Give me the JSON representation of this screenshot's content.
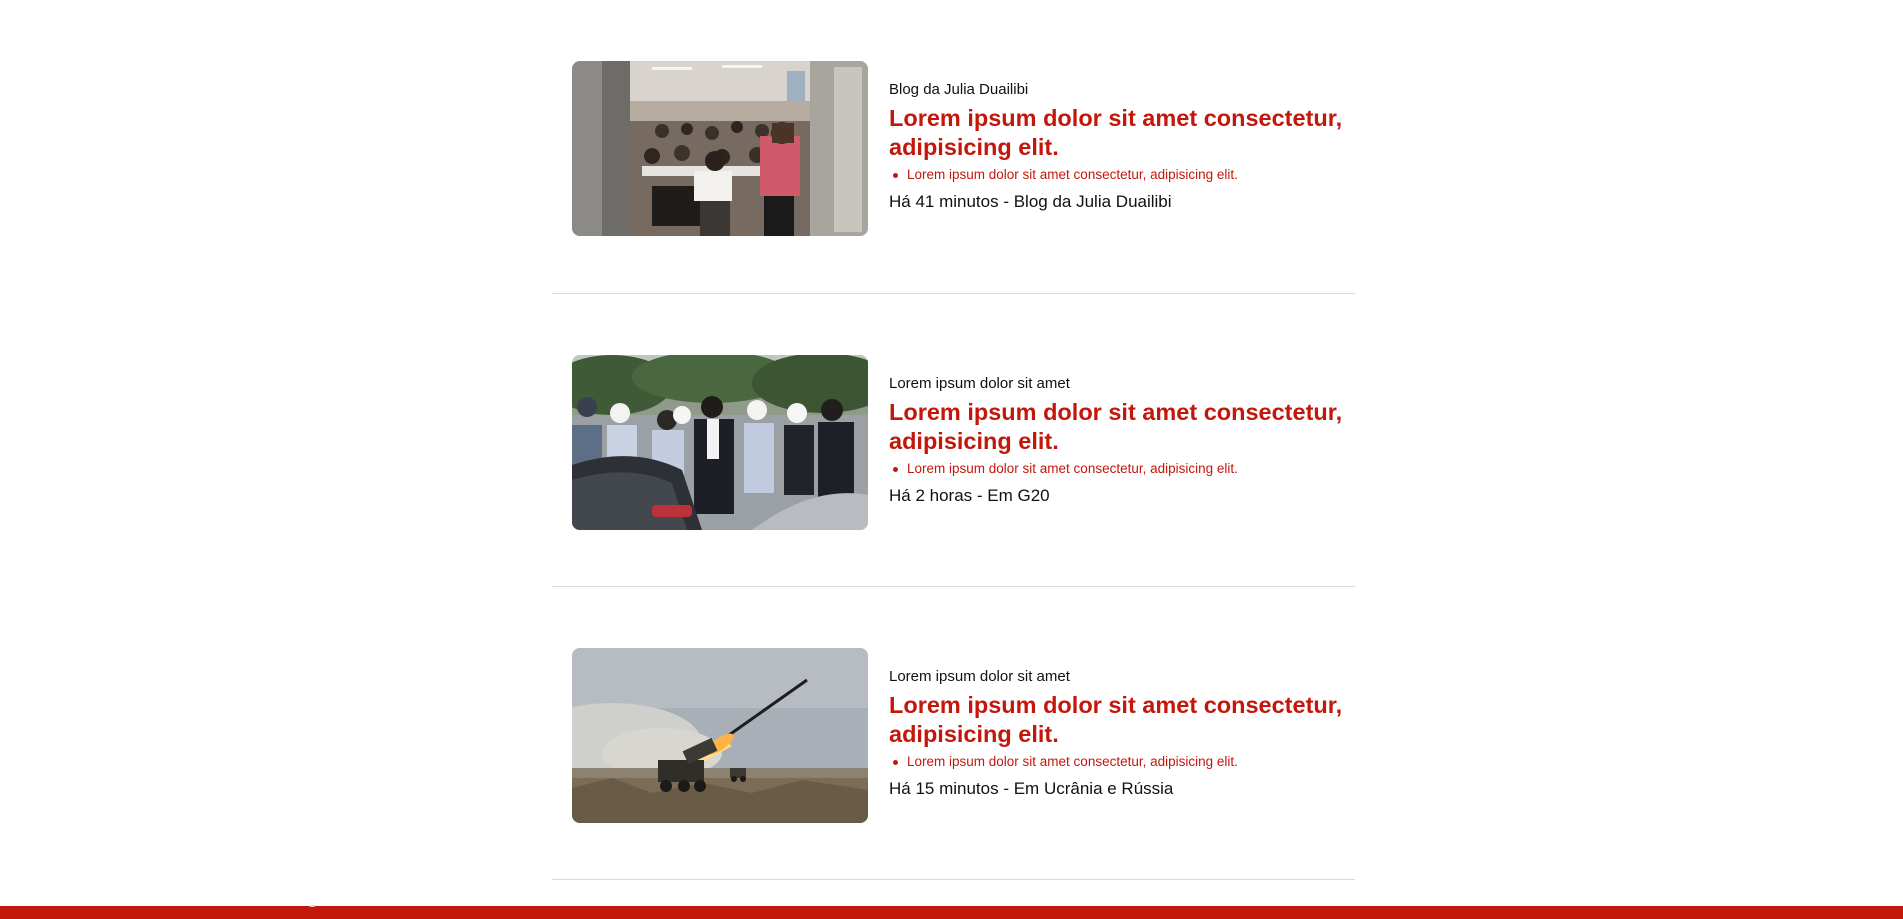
{
  "feed": {
    "items": [
      {
        "kicker": "Blog da Julia Duailibi",
        "headline": "Lorem ipsum dolor sit amet consectetur, adipisicing elit.",
        "bullet": "Lorem ipsum dolor sit amet consectetur, adipisicing elit.",
        "meta": "Há 41 minutos - Blog da Julia Duailibi",
        "image": "classroom-exam-photo"
      },
      {
        "kicker": "Lorem ipsum dolor sit amet",
        "headline": "Lorem ipsum dolor sit amet consectetur, adipisicing elit.",
        "bullet": "Lorem ipsum dolor sit amet consectetur, adipisicing elit.",
        "meta": "Há 2 horas - Em G20",
        "image": "officials-arrival-photo"
      },
      {
        "kicker": "Lorem ipsum dolor sit amet",
        "headline": "Lorem ipsum dolor sit amet consectetur, adipisicing elit.",
        "bullet": "Lorem ipsum dolor sit amet consectetur, adipisicing elit.",
        "meta": "Há 15 minutos - Em Ucrânia e Rússia",
        "image": "rocket-launcher-photo"
      }
    ]
  },
  "colors": {
    "accent": "#c4170c",
    "text": "#111111",
    "divider": "#d9d9d9"
  }
}
